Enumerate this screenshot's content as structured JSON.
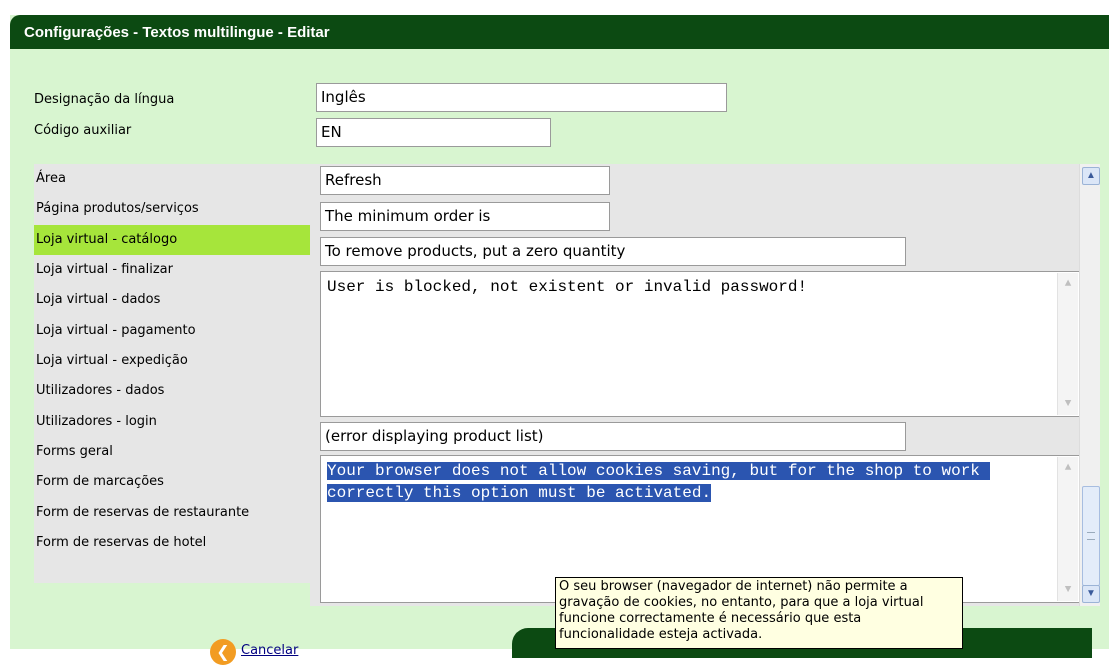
{
  "window": {
    "title": "Configurações - Textos multilingue - Editar"
  },
  "fields": {
    "language_name": {
      "label": "Designação da língua",
      "value": "Inglês"
    },
    "aux_code": {
      "label": "Código auxiliar",
      "value": "EN"
    }
  },
  "menu": {
    "items": [
      {
        "label": "Área"
      },
      {
        "label": "Página produtos/serviços"
      },
      {
        "label": "Loja virtual - catálogo",
        "active": true
      },
      {
        "label": "Loja virtual - finalizar"
      },
      {
        "label": "Loja virtual - dados"
      },
      {
        "label": "Loja virtual - pagamento"
      },
      {
        "label": "Loja virtual - expedição"
      },
      {
        "label": "Utilizadores - dados"
      },
      {
        "label": "Utilizadores - login"
      },
      {
        "label": "Forms geral"
      },
      {
        "label": "Form de marcações"
      },
      {
        "label": "Form de reservas de restaurante"
      },
      {
        "label": "Form de reservas de hotel"
      }
    ],
    "active_color": "#a6e53b"
  },
  "texts": {
    "refresh": "Refresh",
    "min_order": "The minimum order is",
    "remove_products": "To remove products, put a zero quantity",
    "user_blocked": "User is blocked, not existent or invalid password!",
    "product_list_error": "(error displaying product list)",
    "cookies_msg": "Your browser does not allow cookies saving, but for the shop to work correctly this option must be activated."
  },
  "tooltip": {
    "text": "O seu browser (navegador de internet) não permite a gravação de cookies, no entanto, para que a loja virtual funcione correctamente é necessário que esta funcionalidade esteja activada."
  },
  "actions": {
    "cancel_label": "Cancelar"
  },
  "colors": {
    "header": "#0c4a12",
    "panel": "#d8f5d0",
    "selection": "#2b55b0",
    "tooltip_bg": "#ffffe1"
  }
}
